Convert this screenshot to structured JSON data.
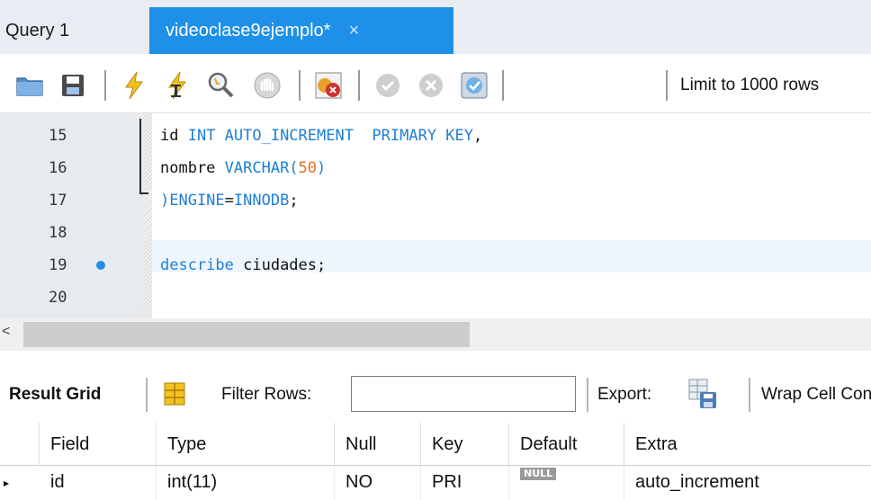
{
  "tabs": [
    {
      "label": "Query 1",
      "active": false
    },
    {
      "label": "videoclase9ejemplo*",
      "active": true,
      "close": "×"
    }
  ],
  "toolbar": {
    "limit_label": "Limit to 1000 rows",
    "icons": [
      "open-folder-icon",
      "save-icon",
      "execute-lightning-icon",
      "execute-cursor-lightning-icon",
      "explain-magnifier-icon",
      "stop-icon",
      "toggle-error-icon",
      "commit-icon",
      "rollback-icon",
      "autocommit-icon"
    ]
  },
  "editor": {
    "lines": [
      {
        "num": "15",
        "tokens": [
          {
            "t": "id ",
            "c": "plain"
          },
          {
            "t": "INT AUTO_INCREMENT  PRIMARY KEY",
            "c": "kw"
          },
          {
            "t": ",",
            "c": "plain"
          }
        ]
      },
      {
        "num": "16",
        "tokens": [
          {
            "t": "nombre ",
            "c": "plain"
          },
          {
            "t": "VARCHAR(",
            "c": "kw"
          },
          {
            "t": "50",
            "c": "num"
          },
          {
            "t": ")",
            "c": "kw"
          }
        ]
      },
      {
        "num": "17",
        "tokens": [
          {
            "t": ")ENGINE",
            "c": "kw"
          },
          {
            "t": "=",
            "c": "plain"
          },
          {
            "t": "INNODB",
            "c": "kw"
          },
          {
            "t": ";",
            "c": "plain"
          }
        ]
      },
      {
        "num": "18",
        "tokens": []
      },
      {
        "num": "19",
        "breakpoint": true,
        "tokens": [
          {
            "t": "describe ",
            "c": "kw"
          },
          {
            "t": "ciudades;",
            "c": "plain"
          }
        ]
      },
      {
        "num": "20",
        "tokens": []
      }
    ]
  },
  "results": {
    "result_grid_label": "Result Grid",
    "filter_rows_label": "Filter Rows:",
    "filter_value": "",
    "export_label": "Export:",
    "wrap_label": "Wrap Cell Content",
    "columns": [
      "Field",
      "Type",
      "Null",
      "Key",
      "Default",
      "Extra"
    ],
    "rows": [
      {
        "marker": "▸",
        "Field": "id",
        "Type": "int(11)",
        "Null": "NO",
        "Key": "PRI",
        "Default": "NULL",
        "Extra": "auto_increment"
      }
    ]
  },
  "colors": {
    "accent": "#1e90e8",
    "keyword": "#1e7fd6",
    "number": "#e8701a"
  }
}
